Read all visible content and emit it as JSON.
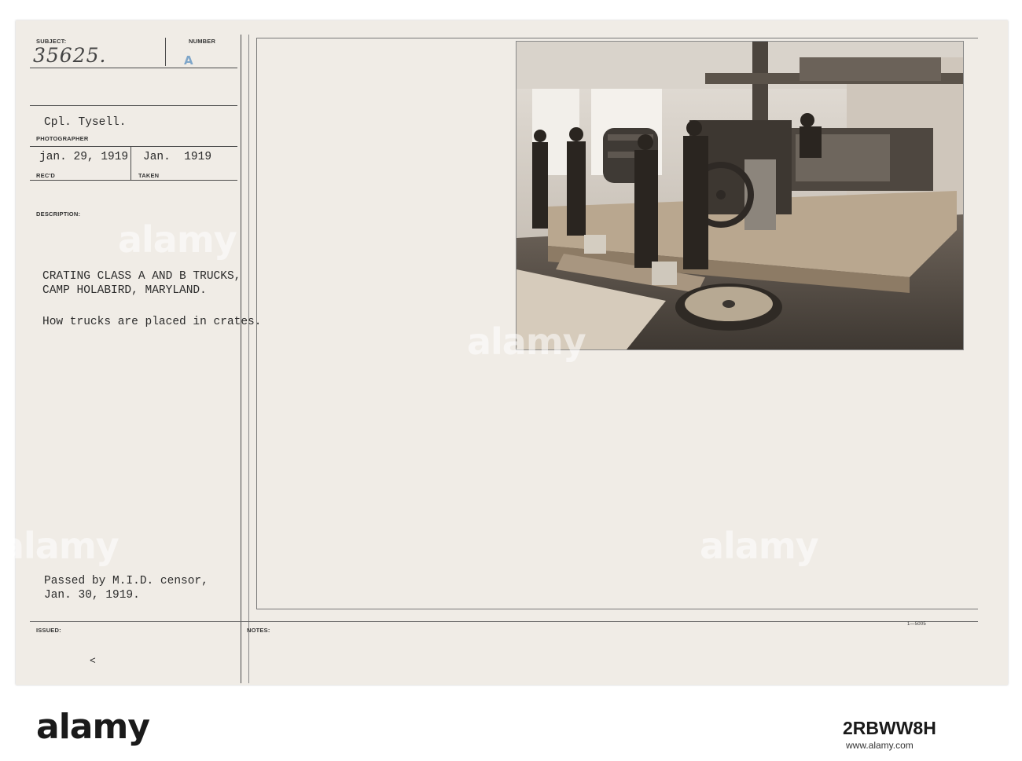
{
  "card": {
    "subject_label": "SUBJECT:",
    "subject_value": "35625.",
    "number_label": "NUMBER",
    "number_value": "A",
    "photographer_value": "Cpl. Tysell.",
    "photographer_label": "PHOTOGRAPHER",
    "recd_value": "jan. 29, 1919",
    "taken_value": "Jan.  1919",
    "recd_label": "REC'D",
    "taken_label": "TAKEN",
    "description_label": "DESCRIPTION:",
    "description_line1": "CRATING CLASS A AND B TRUCKS,",
    "description_line2": "CAMP HOLABIRD, MARYLAND.",
    "description_line3": "How trucks are placed in crates.",
    "censor_line1": "Passed by M.I.D. censor,",
    "censor_line2": "Jan. 30, 1919.",
    "issued_label": "ISSUED:",
    "issued_mark": "<",
    "notes_label": "NOTES:",
    "form_number": "1—5005"
  },
  "watermarks": [
    "alamy",
    "alamy",
    "alamy",
    "alamy",
    "alamy"
  ],
  "footer": {
    "logo": "alamy",
    "image_id": "2RBWW8H",
    "url": "www.alamy.com"
  },
  "icons": [
    "photograph"
  ]
}
